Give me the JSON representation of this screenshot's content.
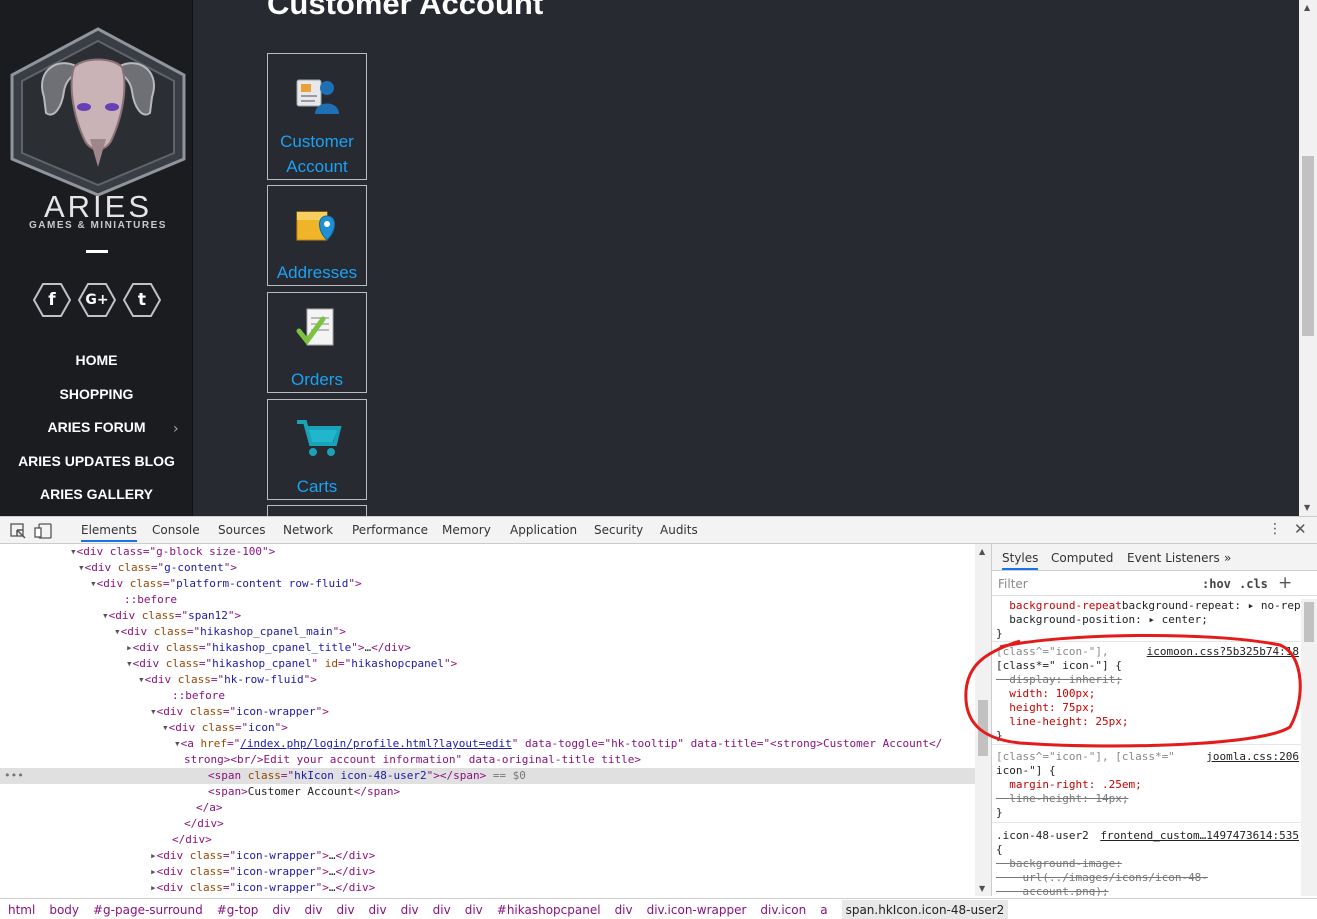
{
  "site": {
    "brand_name": "ARIES",
    "brand_tagline": "GAMES & MINIATURES",
    "social": [
      {
        "name": "facebook-icon",
        "glyph": "f"
      },
      {
        "name": "google-plus-icon",
        "glyph": "G+"
      },
      {
        "name": "tumblr-icon",
        "glyph": "t"
      }
    ],
    "nav": [
      {
        "label": "HOME"
      },
      {
        "label": "SHOPPING"
      },
      {
        "label": "ARIES FORUM",
        "has_submenu": true
      },
      {
        "label": "ARIES UPDATES BLOG"
      },
      {
        "label": "ARIES GALLERY"
      }
    ],
    "page_title": "Customer Account",
    "tiles": [
      {
        "label": "Customer Account",
        "icon": "customer-account-icon"
      },
      {
        "label": "Addresses",
        "icon": "addresses-icon"
      },
      {
        "label": "Orders",
        "icon": "orders-icon"
      },
      {
        "label": "Carts",
        "icon": "carts-icon"
      }
    ]
  },
  "devtools": {
    "tabs": [
      "Elements",
      "Console",
      "Sources",
      "Network",
      "Performance",
      "Memory",
      "Application",
      "Security",
      "Audits"
    ],
    "active_tab": "Elements",
    "dom_lines": [
      {
        "indent": 80,
        "tri": "▾",
        "html": "<div class=\"g-block size-100\">"
      },
      {
        "indent": 88,
        "tri": "▾",
        "tag": "div",
        "attrs": [
          [
            "class",
            "g-content"
          ]
        ]
      },
      {
        "indent": 100,
        "tri": "▾",
        "tag": "div",
        "attrs": [
          [
            "class",
            "platform-content row-fluid"
          ]
        ]
      },
      {
        "indent": 124,
        "tri": "",
        "pseudo": "::before"
      },
      {
        "indent": 112,
        "tri": "▾",
        "tag": "div",
        "attrs": [
          [
            "class",
            "span12"
          ]
        ]
      },
      {
        "indent": 124,
        "tri": "▾",
        "tag": "div",
        "attrs": [
          [
            "class",
            "hikashop_cpanel_main"
          ]
        ]
      },
      {
        "indent": 136,
        "tri": "▸",
        "tag": "div",
        "attrs": [
          [
            "class",
            "hikashop_cpanel_title"
          ]
        ],
        "collapsed": true
      },
      {
        "indent": 136,
        "tri": "▾",
        "tag": "div",
        "attrs": [
          [
            "class",
            "hikashop_cpanel"
          ],
          [
            "id",
            "hikashopcpanel"
          ]
        ]
      },
      {
        "indent": 148,
        "tri": "▾",
        "tag": "div",
        "attrs": [
          [
            "class",
            "hk-row-fluid"
          ]
        ]
      },
      {
        "indent": 172,
        "tri": "",
        "pseudo": "::before"
      },
      {
        "indent": 160,
        "tri": "▾",
        "tag": "div",
        "attrs": [
          [
            "class",
            "icon-wrapper"
          ]
        ]
      },
      {
        "indent": 172,
        "tri": "▾",
        "tag": "div",
        "attrs": [
          [
            "class",
            "icon"
          ]
        ]
      },
      {
        "indent": 184,
        "tri": "▾",
        "raw_a": true
      },
      {
        "indent": 184,
        "tri": "",
        "raw_a2": true
      },
      {
        "indent": 208,
        "tri": "",
        "selected": true,
        "tag": "span",
        "attrs": [
          [
            "class",
            "hkIcon icon-48-user2"
          ]
        ],
        "closed": true,
        "suffix": " == $0"
      },
      {
        "indent": 208,
        "tri": "",
        "tag": "span",
        "attrs": [],
        "text": "Customer Account",
        "closed": true
      },
      {
        "indent": 196,
        "tri": "",
        "close": "a"
      },
      {
        "indent": 184,
        "tri": "",
        "close": "div"
      },
      {
        "indent": 172,
        "tri": "",
        "close": "div"
      },
      {
        "indent": 160,
        "tri": "▸",
        "tag": "div",
        "attrs": [
          [
            "class",
            "icon-wrapper"
          ]
        ],
        "collapsed": true
      },
      {
        "indent": 160,
        "tri": "▸",
        "tag": "div",
        "attrs": [
          [
            "class",
            "icon-wrapper"
          ]
        ],
        "collapsed": true
      },
      {
        "indent": 160,
        "tri": "▸",
        "tag": "div",
        "attrs": [
          [
            "class",
            "icon-wrapper"
          ]
        ],
        "collapsed": true
      },
      {
        "indent": 160,
        "tri": "▸",
        "tag": "div",
        "attrs": [
          [
            "class",
            "icon-wrapper"
          ]
        ],
        "collapsed": true
      }
    ],
    "a_href": "/index.php/login/profile.html?layout=edit",
    "a_line1_tail": "\" data-toggle=\"hk-tooltip\" data-title=\"<strong>Customer Account</",
    "a_line2": "strong><br/>Edit your account information\" data-original-title title>",
    "styles_tabs": [
      "Styles",
      "Computed",
      "Event Listeners",
      "»"
    ],
    "filter_placeholder": "Filter",
    "hov": ":hov",
    "cls": ".cls",
    "rules_text": {
      "r0_l1": "background-repeat: ▸ no-repeat;",
      "r0_l2": "background-position: ▸ center;",
      "r1_sel1": "[class^=\"icon-\"],",
      "r1_src": "icomoon.css?5b325b74:18",
      "r1_sel2": "[class*=\" icon-\"] {",
      "r1_p1": "display: inherit;",
      "r1_p2": "width: 100px;",
      "r1_p3": "height: 75px;",
      "r1_p4": "line-height: 25px;",
      "r2_sel1": "[class^=\"icon-\"], [class*=\"",
      "r2_src": "joomla.css:206",
      "r2_sel2": "icon-\"] {",
      "r2_p1": "margin-right: .25em;",
      "r2_p2": "line-height: 14px;",
      "r3_sel": ".icon-48-user2",
      "r3_src": "frontend_custom…1497473614:535",
      "r3_p1": "background-image:",
      "r3_p2": "url(../images/icons/icon-48-",
      "r3_p3": "account.png);"
    },
    "breadcrumbs": [
      "html",
      "body",
      "#g-page-surround",
      "#g-top",
      "div",
      "div",
      "div",
      "div",
      "div",
      "div",
      "div",
      "#hikashopcpanel",
      "div",
      "div.icon-wrapper",
      "div.icon",
      "a",
      "span.hkIcon.icon-48-user2"
    ]
  }
}
